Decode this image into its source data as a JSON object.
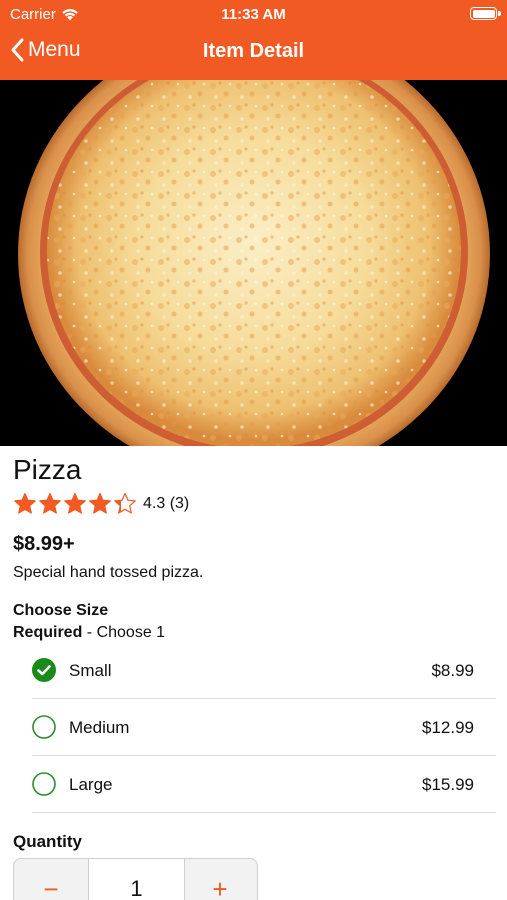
{
  "status_bar": {
    "carrier": "Carrier",
    "time": "11:33 AM"
  },
  "nav": {
    "back_label": "Menu",
    "title": "Item Detail"
  },
  "item": {
    "name": "Pizza",
    "rating_value": 4.3,
    "rating_text": "4.3 (3)",
    "price": "$8.99+",
    "description": "Special hand tossed pizza."
  },
  "size_group": {
    "title": "Choose Size",
    "required_label": "Required",
    "required_rule": " - Choose 1",
    "options": [
      {
        "label": "Small",
        "price": "$8.99",
        "selected": true
      },
      {
        "label": "Medium",
        "price": "$12.99",
        "selected": false
      },
      {
        "label": "Large",
        "price": "$15.99",
        "selected": false
      }
    ]
  },
  "quantity": {
    "label": "Quantity",
    "value": "1",
    "minus": "−",
    "plus": "+"
  },
  "colors": {
    "accent": "#f15a22",
    "star": "#f15a22",
    "check": "#1a8a1a",
    "radio_empty": "#2e8b2e"
  }
}
